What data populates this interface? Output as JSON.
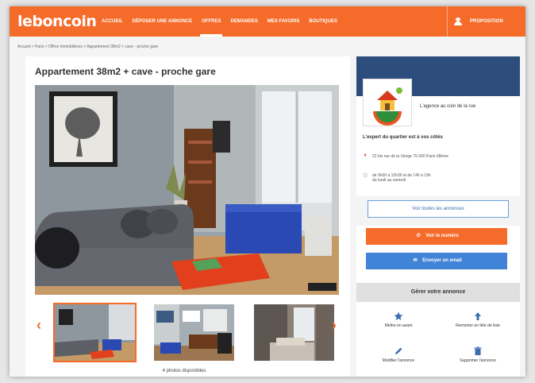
{
  "colors": {
    "brand": "#f56b2a",
    "blue": "#4183d7",
    "agency_banner": "#2d4e7c"
  },
  "nav": {
    "logo": "leboncoin",
    "items": [
      "ACCUEIL",
      "DÉPOSER UNE ANNONCE",
      "OFFRES",
      "DEMANDES",
      "MES FAVORIS",
      "BOUTIQUES"
    ],
    "account_label": "PROPOSITION"
  },
  "breadcrumb": "Accueil > Paris > Offres immobilières > Appartement 38m2 + cave - proche gare",
  "listing": {
    "title": "Appartement 38m2 + cave - proche gare",
    "photo_count": "4 photos disponibles"
  },
  "agency": {
    "name": "L'agence au coin de la rue",
    "tagline": "L'expert du quartier est à vos côtés",
    "address": "22 bis rue de la Vierge 75 000 Paris 08ème",
    "hours_line1": "de 9h30 à 12h30 et de 14h à 19h",
    "hours_line2": "du lundi au samedi",
    "see_all_label": "Voir toutes les annonces"
  },
  "contact": {
    "call_label": "Voir le numéro",
    "email_label": "Envoyer un email"
  },
  "manage": {
    "header": "Gérer votre annonce",
    "items": [
      {
        "label": "Mettre en avant",
        "icon": "star-icon"
      },
      {
        "label": "Remonter en tête de liste",
        "icon": "arrow-up-icon"
      },
      {
        "label": "Modifier l'annonce",
        "icon": "pencil-icon"
      },
      {
        "label": "Supprimer l'annonce",
        "icon": "trash-icon"
      }
    ]
  }
}
